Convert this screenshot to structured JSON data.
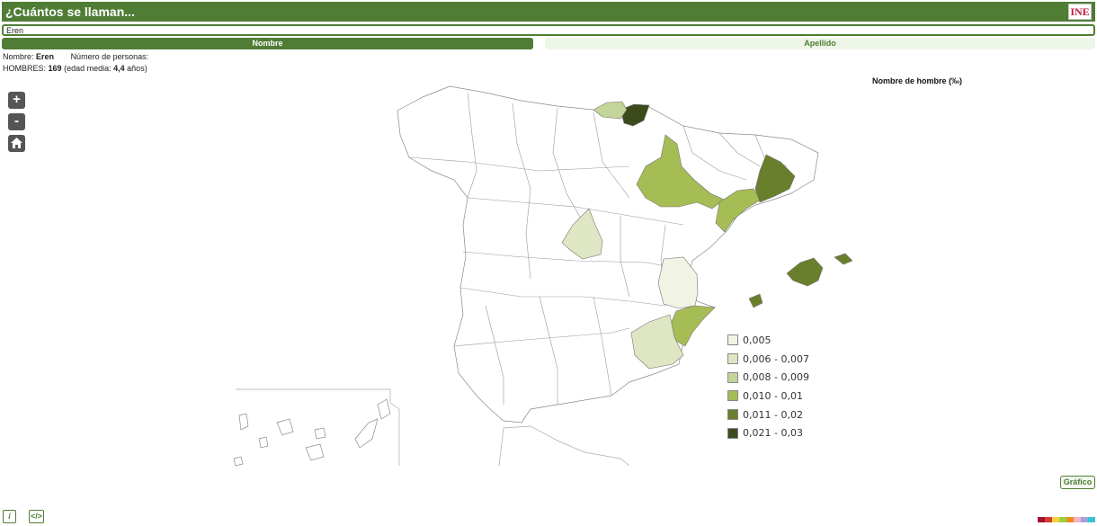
{
  "header": {
    "title": "¿Cuántos se llaman...",
    "logo_text": "INE"
  },
  "search": {
    "value": "Eren"
  },
  "tabs": [
    {
      "label": "Nombre"
    },
    {
      "label": "Apellido"
    }
  ],
  "info": {
    "nombre_label": "Nombre:",
    "nombre_value": "Eren",
    "personas_label": "Número de personas:",
    "hombres_label": "HOMBRES:",
    "hombres_value": "169",
    "edad_label_open": "(edad media:",
    "edad_value": "4,4",
    "edad_label_close": "años)"
  },
  "map_controls": {
    "zoom_in": "+",
    "zoom_out": "-",
    "home_icon": "home-icon"
  },
  "legend": {
    "title": "Nombre de hombre (‰)",
    "items": [
      {
        "label": "0,005",
        "color": "#f1f3e4"
      },
      {
        "label": "0,006 - 0,007",
        "color": "#dfe6c4"
      },
      {
        "label": "0,008 - 0,009",
        "color": "#c4d599"
      },
      {
        "label": "0,010 - 0,01",
        "color": "#a6bc54"
      },
      {
        "label": "0,011 - 0,02",
        "color": "#6a7f2c"
      },
      {
        "label": "0,021 - 0,03",
        "color": "#3c4a1c"
      }
    ]
  },
  "regions": [
    {
      "name": "Gipuzkoa",
      "class": "0,021 - 0,03"
    },
    {
      "name": "Bizkaia",
      "class": "0,008 - 0,009"
    },
    {
      "name": "Zaragoza",
      "class": "0,010 - 0,01"
    },
    {
      "name": "Tarragona",
      "class": "0,010 - 0,01"
    },
    {
      "name": "Barcelona",
      "class": "0,011 - 0,02"
    },
    {
      "name": "Madrid",
      "class": "0,006 - 0,007"
    },
    {
      "name": "Valencia",
      "class": "0,005"
    },
    {
      "name": "Alicante",
      "class": "0,010 - 0,01"
    },
    {
      "name": "Murcia",
      "class": "0,006 - 0,007"
    },
    {
      "name": "Mallorca",
      "class": "0,011 - 0,02"
    },
    {
      "name": "Menorca",
      "class": "0,011 - 0,02"
    },
    {
      "name": "Ibiza",
      "class": "0,011 - 0,02"
    }
  ],
  "buttons": {
    "grafico": "Gráfico"
  },
  "footer": {
    "info_icon": "i",
    "embed_icon": "</>"
  },
  "palette": [
    "#a0132a",
    "#d63a3a",
    "#f7d33c",
    "#9bd13b",
    "#f08a1e",
    "#f5b3c8",
    "#a3a3d8",
    "#3ac3d6"
  ]
}
